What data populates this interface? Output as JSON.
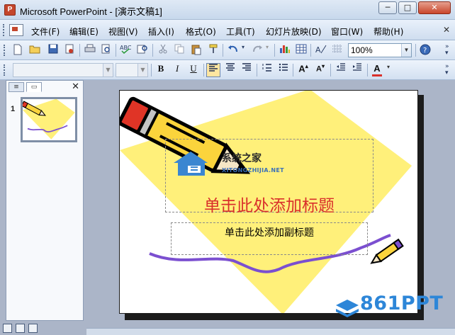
{
  "window": {
    "title": "Microsoft PowerPoint - [演示文稿1]",
    "minimize_label": "─",
    "maximize_label": "□",
    "close_label": "✕"
  },
  "menu": {
    "items": [
      {
        "label": "文件(F)"
      },
      {
        "label": "编辑(E)"
      },
      {
        "label": "视图(V)"
      },
      {
        "label": "插入(I)"
      },
      {
        "label": "格式(O)"
      },
      {
        "label": "工具(T)"
      },
      {
        "label": "幻灯片放映(D)"
      },
      {
        "label": "窗口(W)"
      },
      {
        "label": "帮助(H)"
      }
    ]
  },
  "toolbar": {
    "zoom_value": "100%"
  },
  "format_toolbar": {
    "bold": "B",
    "italic": "I",
    "underline": "U"
  },
  "slide_panel": {
    "slide_number": "1"
  },
  "slide": {
    "title_placeholder": "单击此处添加标题",
    "subtitle_placeholder": "单击此处添加副标题"
  },
  "watermark": {
    "site_name": "系统之家",
    "site_url": "XITONGZHIJIA.NET",
    "brand": "861PPT"
  },
  "colors": {
    "title_red": "#d9302b",
    "diamond_yellow": "#fff07a",
    "curve_purple": "#7b4fd0",
    "brand_blue": "#2d86d8"
  }
}
